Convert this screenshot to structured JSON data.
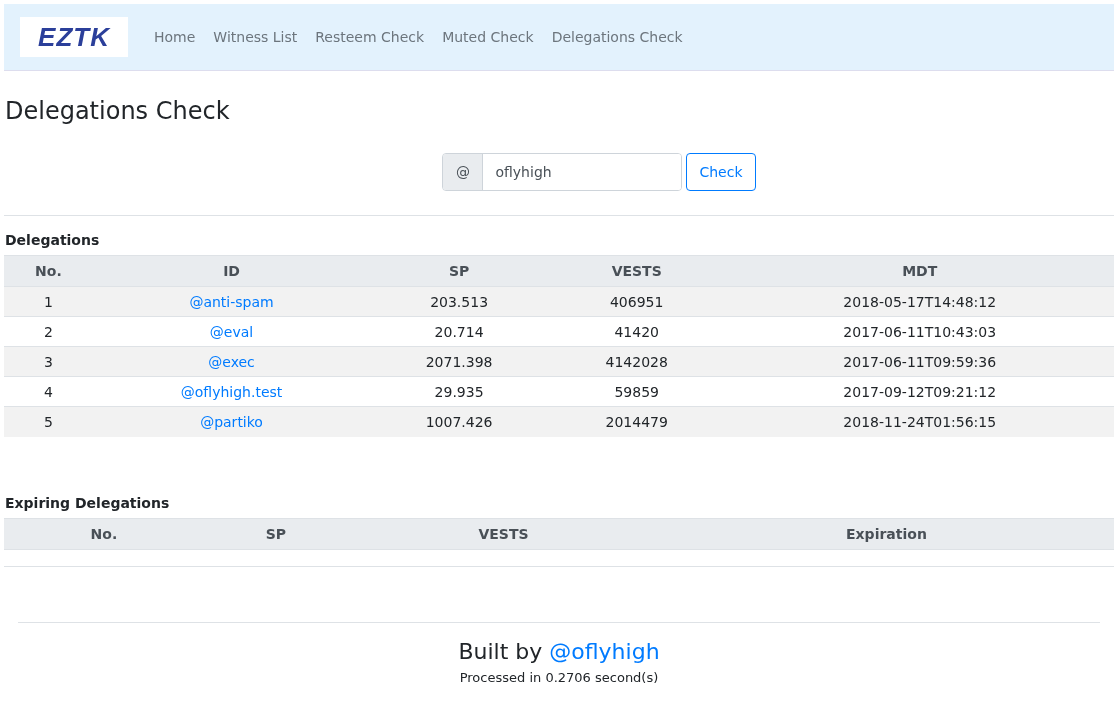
{
  "navbar": {
    "logo": "EZTK",
    "links": [
      {
        "label": "Home",
        "selected": false
      },
      {
        "label": "Witness List",
        "selected": false
      },
      {
        "label": "Resteem Check",
        "selected": false
      },
      {
        "label": "Muted Check",
        "selected": false
      },
      {
        "label": "Delegations Check",
        "selected": false
      }
    ]
  },
  "page_title": "Delegations Check",
  "search": {
    "prefix": "@",
    "value": "oflyhigh",
    "button": "Check"
  },
  "delegations": {
    "title": "Delegations",
    "columns": [
      "No.",
      "ID",
      "SP",
      "VESTS",
      "MDT"
    ],
    "rows": [
      [
        "1",
        "@anti-spam",
        "203.513",
        "406951",
        "2018-05-17T14:48:12"
      ],
      [
        "2",
        "@eval",
        "20.714",
        "41420",
        "2017-06-11T10:43:03"
      ],
      [
        "3",
        "@exec",
        "2071.398",
        "4142028",
        "2017-06-11T09:59:36"
      ],
      [
        "4",
        "@oflyhigh.test",
        "29.935",
        "59859",
        "2017-09-12T09:21:12"
      ],
      [
        "5",
        "@partiko",
        "1007.426",
        "2014479",
        "2018-11-24T01:56:15"
      ]
    ]
  },
  "expiring": {
    "title": "Expiring Delegations",
    "columns": [
      "No.",
      "SP",
      "VESTS",
      "Expiration"
    ]
  },
  "footer": {
    "built_by": "Built by",
    "author": "@oflyhigh",
    "processed": "Processed in 0.2706 second(s)"
  }
}
